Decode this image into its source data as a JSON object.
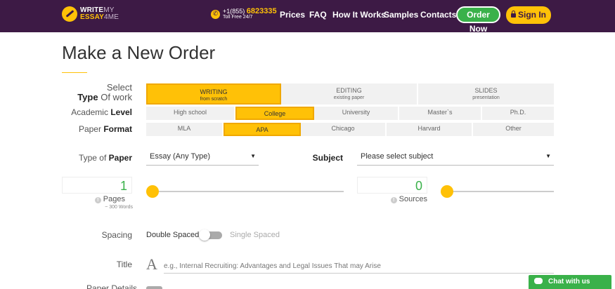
{
  "header": {
    "logo": {
      "line1_bold": "WRITE",
      "line1_thin": "MY",
      "line2_bold": "ESSAY",
      "line2_thin": "4ME"
    },
    "phone": {
      "prefix": "+1(855)",
      "number": "6823335",
      "sub": "Toll Free 24/7"
    },
    "nav": [
      "Prices",
      "FAQ",
      "How It Works",
      "Samples",
      "Contacts"
    ],
    "order_now": "Order Now",
    "sign_in": "Sign In"
  },
  "page_title": "Make a New Order",
  "type_of_work": {
    "label_line1": "Select",
    "label_line2_bold": "Type",
    "label_line2_rest": "Of work",
    "options": [
      {
        "main": "WRITING",
        "sub": "from scratch",
        "selected": true
      },
      {
        "main": "EDITING",
        "sub": "existing paper",
        "selected": false
      },
      {
        "main": "SLIDES",
        "sub": "presentation",
        "selected": false
      }
    ]
  },
  "academic_level": {
    "label_plain": "Academic",
    "label_bold": "Level",
    "options": [
      "High school",
      "College",
      "University",
      "Master`s",
      "Ph.D."
    ],
    "selected": "College"
  },
  "paper_format": {
    "label_plain": "Paper",
    "label_bold": "Format",
    "options": [
      "MLA",
      "APA",
      "Chicago",
      "Harvard",
      "Other"
    ],
    "selected": "APA"
  },
  "type_of_paper": {
    "label_plain": "Type of",
    "label_bold": "Paper",
    "value": "Essay (Any Type)"
  },
  "subject": {
    "label": "Subject",
    "value": "Please select subject"
  },
  "pages": {
    "value": "1",
    "caption": "Pages",
    "sub": "~ 300 Words",
    "slider_fraction": 0
  },
  "sources": {
    "value": "0",
    "caption": "Sources",
    "slider_fraction": 0
  },
  "spacing": {
    "label": "Spacing",
    "on_label": "Double Spaced",
    "off_label": "Single Spaced"
  },
  "title": {
    "label": "Title",
    "icon_glyph": "A",
    "placeholder": "e.g., Internal Recruiting: Advantages and Legal Issues That may Arise"
  },
  "next_row_label": "Paper Details",
  "chat": {
    "label": "Chat with us"
  },
  "colors": {
    "header_bg": "#3d1a45",
    "accent": "#ffc107",
    "green": "#3ab14a"
  }
}
